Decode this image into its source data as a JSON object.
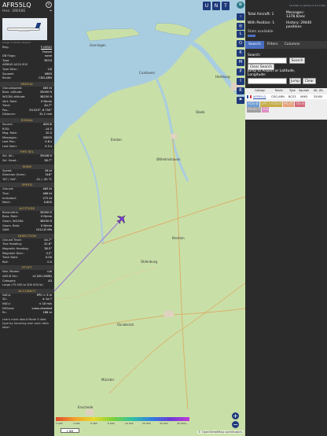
{
  "aircraft": {
    "callsign": "AFR55LQ",
    "hex_label": "Hex:",
    "hex": "39E68E",
    "photo_credit": "Image © Martin Oswald",
    "reg_label": "Reg.:",
    "reg": "F-HZUO",
    "country": "France",
    "db_flags_label": "DB Flags:",
    "db_flags": "none",
    "type_label": "Type:",
    "type": "BCS3",
    "model": "AIRBUS A220-300",
    "type_desc_label": "Type Desc.:",
    "type_desc": "L2J",
    "squawk_label": "Squawk:",
    "squawk": "0663",
    "route_label": "Route:",
    "route": "CDG-ARN"
  },
  "sections": {
    "spatial": {
      "title": "SPATIAL",
      "rows": [
        {
          "k": "Groundspeed:",
          "v": "465 kt"
        },
        {
          "k": "Baro. altitude:",
          "v": "35000 ft"
        },
        {
          "k": "WGS84 altitude:",
          "v": "36250 ft"
        },
        {
          "k": "Vert. Rate:",
          "v": "0 ft/min"
        },
        {
          "k": "Track:",
          "v": "44.7°"
        },
        {
          "k": "Pos.:",
          "v": "53.523°, 6.750°"
        },
        {
          "k": "Distance:",
          "v": "31.1 nmi"
        }
      ]
    },
    "signal": {
      "title": "SIGNAL",
      "rows": [
        {
          "k": "Source:",
          "v": "ADS-B"
        },
        {
          "k": "RSSI:",
          "v": "-14.5"
        },
        {
          "k": "Msg. Rate:",
          "v": "20.5"
        },
        {
          "k": "Messages:",
          "v": "33055"
        },
        {
          "k": "Last Pos.:",
          "v": "0.8 s"
        },
        {
          "k": "Last Seen:",
          "v": "0.3 s"
        }
      ]
    },
    "fms": {
      "title": "FMS SEL",
      "rows": [
        {
          "k": "Sel. Alt.:",
          "v": "35008 ft"
        },
        {
          "k": "Sel. Head.:",
          "v": "38.7°"
        }
      ]
    },
    "wind": {
      "title": "WIND",
      "rows": [
        {
          "k": "Speed:",
          "v": "26 kt"
        },
        {
          "k": "Direction (from):",
          "v": "318°"
        },
        {
          "k": "TAT / OAT:",
          "v": "-21 / -50 °C"
        }
      ]
    },
    "speed": {
      "title": "SPEED",
      "rows": [
        {
          "k": "Ground:",
          "v": "465 kt"
        },
        {
          "k": "True:",
          "v": "466 kt"
        },
        {
          "k": "Indicated:",
          "v": "272 kt"
        },
        {
          "k": "Mach:",
          "v": "0.800"
        }
      ]
    },
    "altitude": {
      "title": "ALTITUDE",
      "rows": [
        {
          "k": "Barometric:",
          "v": "35000 ft"
        },
        {
          "k": "Baro. Rate:",
          "v": "0 ft/min"
        },
        {
          "k": "Geom. WGS84:",
          "v": "36250 ft"
        },
        {
          "k": "Geom. Rate:",
          "v": "0 ft/min"
        },
        {
          "k": "QNH:",
          "v": "1012.8 hPa"
        }
      ]
    },
    "direction": {
      "title": "DIRECTION",
      "rows": [
        {
          "k": "Ground Track:",
          "v": "44.7°"
        },
        {
          "k": "True Heading:",
          "v": "41.6°"
        },
        {
          "k": "Magnetic Heading:",
          "v": "38.5°"
        },
        {
          "k": "Magnetic Decl.:",
          "v": "3.2°"
        },
        {
          "k": "Track Rate:",
          "v": "0.00"
        },
        {
          "k": "Roll:",
          "v": "0.0"
        }
      ]
    },
    "stuff": {
      "title": "STUFF",
      "rows": [
        {
          "k": "Nav. Modes:",
          "v": "n/a"
        },
        {
          "k": "ADS-B Ver.:",
          "v": "v2 (DO-260B)"
        },
        {
          "k": "Category:",
          "v": "A3"
        },
        {
          "k": "Large (75 000 to 300 000 lb)",
          "v": ""
        }
      ]
    },
    "accuracy": {
      "title": "ACCURACY",
      "rows": [
        {
          "k": "NACp:",
          "v": "EPU < 3 m"
        },
        {
          "k": "SIL:",
          "v": "≤ 1e-7"
        },
        {
          "k": "NACv:",
          "v": "< 10 m/s"
        },
        {
          "k": "NICbaro:",
          "v": "cross-checked"
        },
        {
          "k": "Rc:",
          "v": "186 m"
        }
      ]
    },
    "footer": "Learn more about Mode S data type by hovering over each data label."
  },
  "map": {
    "labels": [
      "Hamburg",
      "Bremen",
      "Groningen",
      "Emden",
      "Oldenburg",
      "Wilhelmshaven",
      "Cuxhaven",
      "Stade",
      "Osnabrück",
      "Münster",
      "Enschede"
    ],
    "scale_ticks": [
      "2 000",
      "4 000",
      "6 000",
      "8 000",
      "10 000",
      "20 000",
      "30 000",
      "40 000+"
    ],
    "scale_box": "1 NM",
    "copyright": "© OpenStreetMap contributors."
  },
  "controls": {
    "top": [
      "U",
      "N",
      "T"
    ],
    "side": [
      "L",
      "O",
      "K",
      "M",
      "P",
      "I",
      "R"
    ],
    "zoom_in": "+",
    "zoom_out": "−"
  },
  "sidebar": {
    "github": "tar1090 on github (3.14.1796)",
    "total_label": "Total Aircraft:",
    "total": "1",
    "with_pos_label": "With Position:",
    "with_pos": "1",
    "stats": "Stats available",
    "messages_label": "Messages:",
    "messages": "1378.6/sec",
    "history_label": "History:",
    "history": "29440 positions",
    "tabs": [
      "Search",
      "Filters",
      "Columns"
    ],
    "search_label": "Search:",
    "search_button": "Search",
    "clear_search_button": "Clear Search",
    "jump_label": "Jump to Airport or Latitude, Longitude:",
    "jump_button": "Jump",
    "clear_button": "Clear",
    "table_headers": [
      "Callsign",
      "Route",
      "Type",
      "Squawk",
      "Alt. (ft)"
    ],
    "table_row": {
      "callsign": "AFR55LQ",
      "route": "CDG-ARN",
      "type": "BCS3",
      "squawk": "0663",
      "alt": "35000"
    },
    "legend": [
      "ADS-B",
      "UAT / ADS-R",
      "MLAT",
      "TIS-B",
      "Mode-S",
      "AIS"
    ],
    "legend_colors": [
      "#6f9ed8",
      "#c7ad43",
      "#e8a37b",
      "#d86a7a",
      "#9e9e9e",
      "#e08fc4"
    ]
  }
}
